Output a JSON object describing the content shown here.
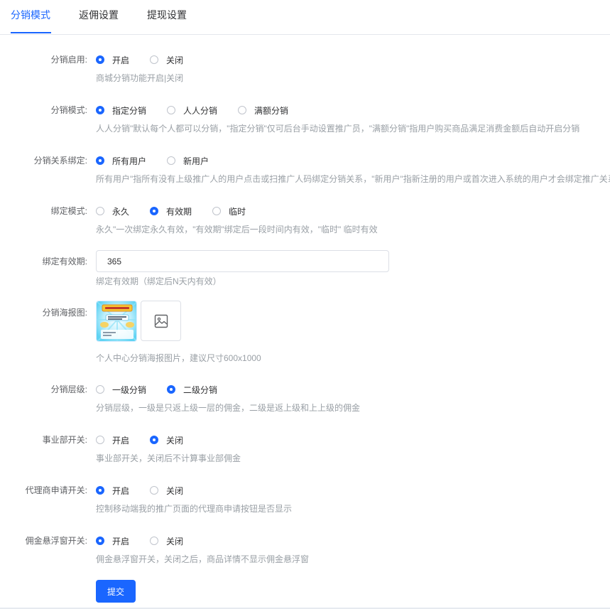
{
  "tabs": [
    {
      "label": "分销模式",
      "active": true
    },
    {
      "label": "返佣设置",
      "active": false
    },
    {
      "label": "提现设置",
      "active": false
    }
  ],
  "colors": {
    "accent": "#1a66ff",
    "help_text": "#9aa0a6",
    "label_text": "#606266"
  },
  "form": {
    "distribution_enabled": {
      "label": "分销启用:",
      "options": [
        "开启",
        "关闭"
      ],
      "selected": 0,
      "help": "商城分销功能开启|关闭"
    },
    "distribution_mode": {
      "label": "分销模式:",
      "options": [
        "指定分销",
        "人人分销",
        "满额分销"
      ],
      "selected": 0,
      "help": "人人分销\"默认每个人都可以分销，\"指定分销\"仅可后台手动设置推广员，\"满额分销\"指用户购买商品满足消费金额后自动开启分销"
    },
    "relation_binding": {
      "label": "分销关系绑定:",
      "options": [
        "所有用户",
        "新用户"
      ],
      "selected": 0,
      "help": "所有用户\"指所有没有上级推广人的用户点击或扫推广人码绑定分销关系，\"新用户\"指新注册的用户或首次进入系统的用户才会绑定推广关系"
    },
    "binding_mode": {
      "label": "绑定模式:",
      "options": [
        "永久",
        "有效期",
        "临时"
      ],
      "selected": 1,
      "help": "永久\"一次绑定永久有效，\"有效期\"绑定后一段时间内有效，\"临时\" 临时有效"
    },
    "binding_period": {
      "label": "绑定有效期:",
      "value": "365",
      "help": "绑定有效期（绑定后N天内有效）"
    },
    "poster": {
      "label": "分销海报图:",
      "help": "个人中心分销海报图片，建议尺寸600x1000",
      "icon": "image-icon"
    },
    "distribution_level": {
      "label": "分销层级:",
      "options": [
        "一级分销",
        "二级分销"
      ],
      "selected": 1,
      "help": "分销层级，一级是只返上级一层的佣金，二级是返上级和上上级的佣金"
    },
    "division_switch": {
      "label": "事业部开关:",
      "options": [
        "开启",
        "关闭"
      ],
      "selected": 1,
      "help": "事业部开关，关闭后不计算事业部佣金"
    },
    "agent_apply_switch": {
      "label": "代理商申请开关:",
      "options": [
        "开启",
        "关闭"
      ],
      "selected": 0,
      "help": "控制移动端我的推广页面的代理商申请按钮是否显示"
    },
    "commission_float_switch": {
      "label": "佣金悬浮窗开关:",
      "options": [
        "开启",
        "关闭"
      ],
      "selected": 0,
      "help": "佣金悬浮窗开关，关闭之后，商品详情不显示佣金悬浮窗"
    }
  },
  "submit_label": "提交"
}
